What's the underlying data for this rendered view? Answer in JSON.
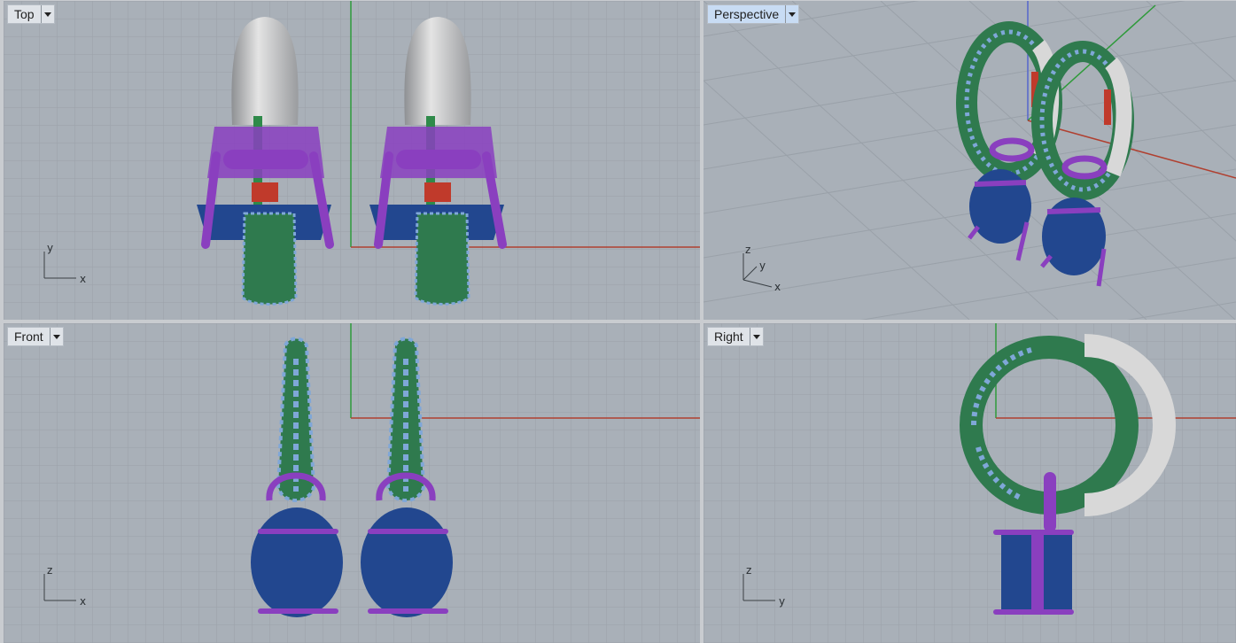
{
  "viewports": {
    "top": {
      "label": "Top",
      "axes": {
        "a": "y",
        "b": "x"
      }
    },
    "perspective": {
      "label": "Perspective",
      "axes": {
        "a": "z",
        "b": "y",
        "c": "x"
      }
    },
    "front": {
      "label": "Front",
      "axes": {
        "a": "z",
        "b": "x"
      }
    },
    "right": {
      "label": "Right",
      "axes": {
        "a": "z",
        "b": "y"
      }
    }
  },
  "colors": {
    "background": "#a9b0b8",
    "grid": "#9aa1a9",
    "x_axis": "#b04030",
    "y_axis": "#2e9a3a",
    "z_axis": "#5566cc",
    "metal_silver": "#d8d8d8",
    "metal_green": "#2f8a4a",
    "prongs_purple": "#8a3fbf",
    "gem_blue": "#22478f",
    "pave_stones": "#7fa7d8",
    "accent_red": "#c03a2b"
  }
}
